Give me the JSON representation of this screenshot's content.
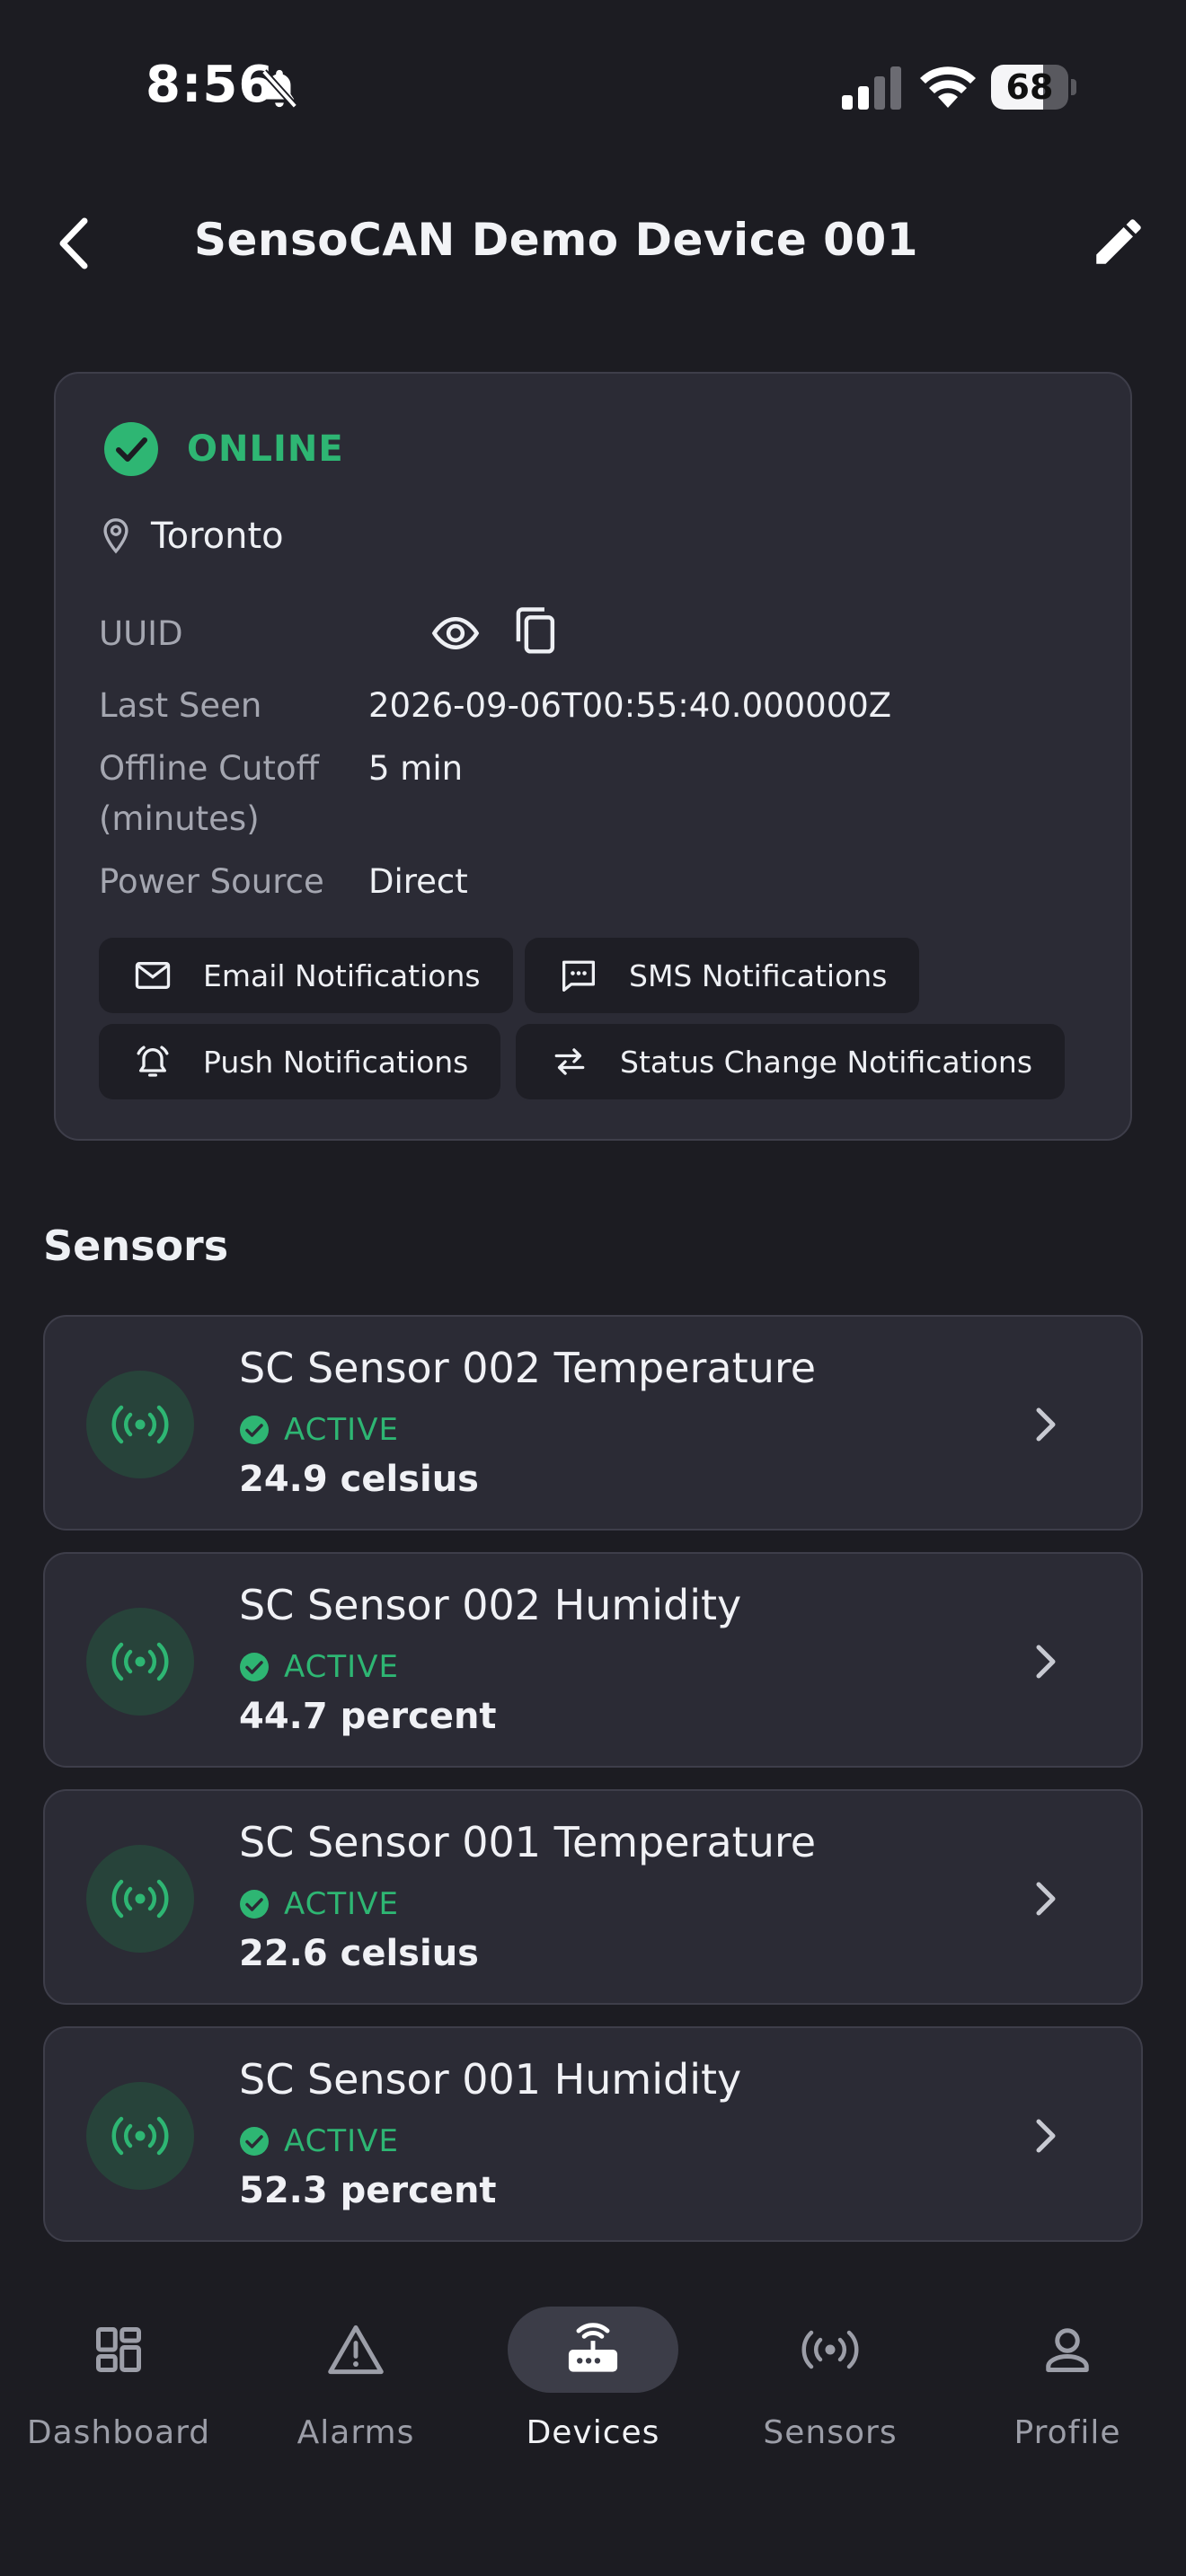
{
  "status_bar": {
    "time": "8:56",
    "battery_percent": "68",
    "battery_level": 0.68,
    "icons": [
      "bell-off-icon",
      "cellular-signal-icon",
      "wifi-icon",
      "battery-icon"
    ]
  },
  "header": {
    "title": "SensoCAN Demo Device 001",
    "back_icon": "chevron-left-icon",
    "edit_icon": "pencil-icon"
  },
  "device": {
    "status": "ONLINE",
    "location": "Toronto",
    "fields": [
      {
        "label": "UUID",
        "value": ""
      },
      {
        "label": "Last Seen",
        "value": "2026-09-06T00:55:40.000000Z"
      },
      {
        "label": "Offline Cutoff\n(minutes)",
        "value": "5 min"
      },
      {
        "label": "Power Source",
        "value": "Direct"
      }
    ],
    "notifications": [
      {
        "label": "Email Notifications",
        "icon": "mail-icon"
      },
      {
        "label": "SMS Notifications",
        "icon": "sms-icon"
      },
      {
        "label": "Push Notifications",
        "icon": "alarm-bell-icon"
      },
      {
        "label": "Status Change Notifications",
        "icon": "swap-arrows-icon"
      }
    ]
  },
  "sensors": {
    "title": "Sensors",
    "items": [
      {
        "name": "SC Sensor 002 Temperature",
        "status": "ACTIVE",
        "value": "24.9 celsius"
      },
      {
        "name": "SC Sensor 002 Humidity",
        "status": "ACTIVE",
        "value": "44.7 percent"
      },
      {
        "name": "SC Sensor 001 Temperature",
        "status": "ACTIVE",
        "value": "22.6 celsius"
      },
      {
        "name": "SC Sensor 001 Humidity",
        "status": "ACTIVE",
        "value": "52.3 percent"
      }
    ]
  },
  "nav": {
    "active": "Devices",
    "items": [
      {
        "label": "Dashboard",
        "icon": "dashboard-icon"
      },
      {
        "label": "Alarms",
        "icon": "warning-icon"
      },
      {
        "label": "Devices",
        "icon": "router-icon"
      },
      {
        "label": "Sensors",
        "icon": "sensors-icon"
      },
      {
        "label": "Profile",
        "icon": "person-icon"
      }
    ]
  },
  "colors": {
    "background": "#1c1c22",
    "card": "#2b2b35",
    "accent_green": "#2eb673",
    "muted_text": "#a4a6b0"
  }
}
